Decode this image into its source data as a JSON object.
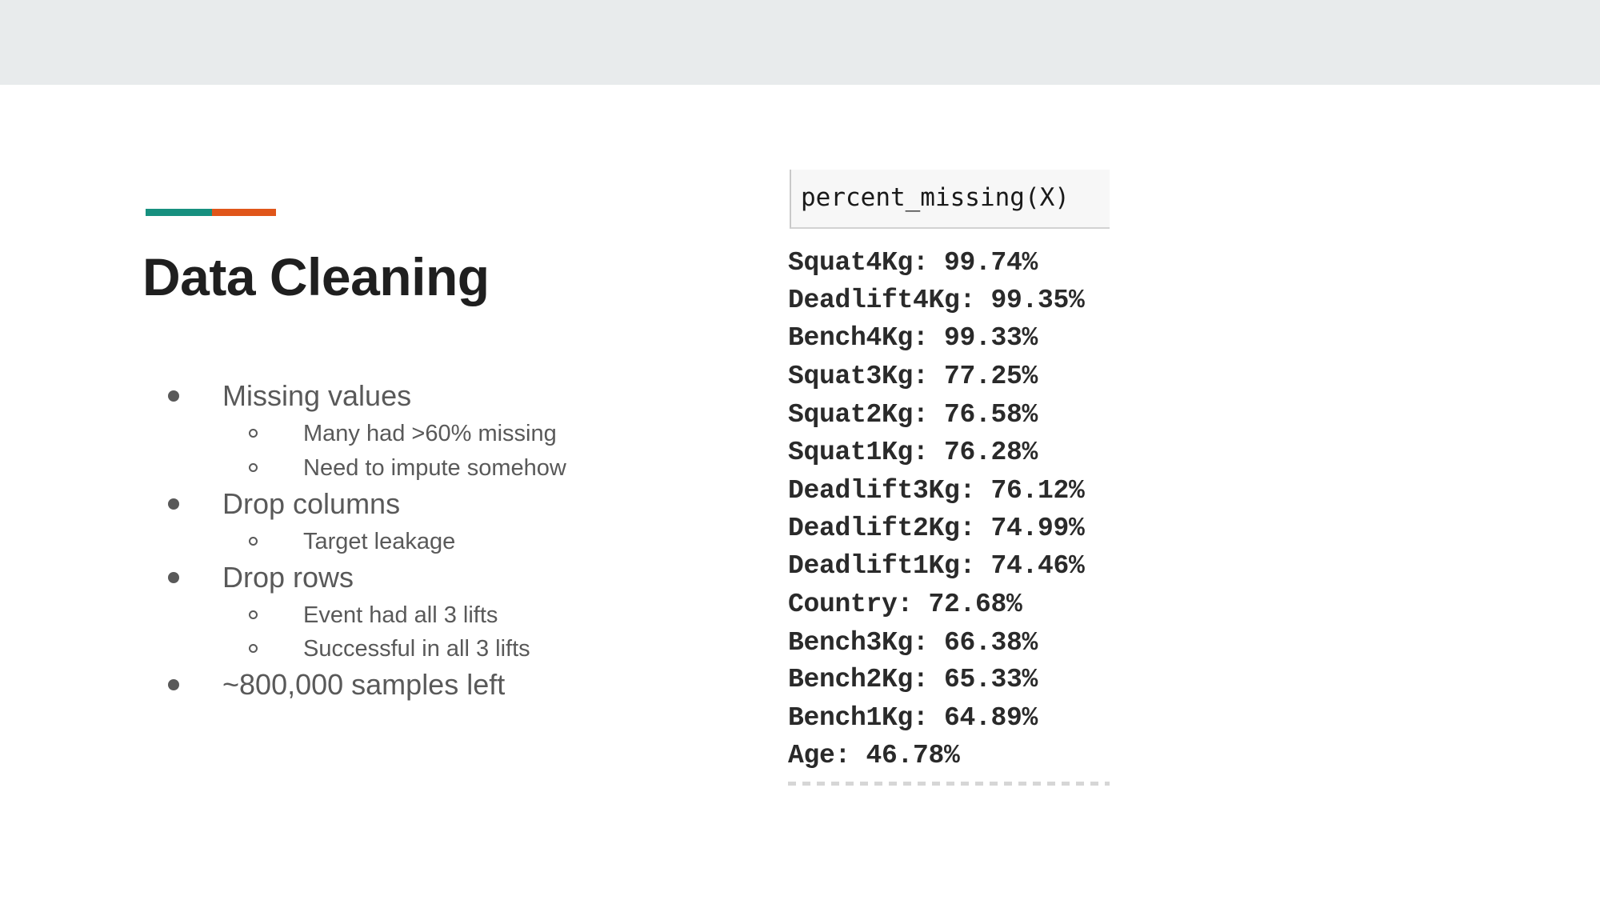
{
  "slide": {
    "title": "Data Cleaning",
    "accent_colors": {
      "teal": "#17907f",
      "orange": "#e0561a"
    },
    "bullets": [
      {
        "text": "Missing values",
        "level": 1
      },
      {
        "text": "Many had >60% missing",
        "level": 2
      },
      {
        "text": "Need to impute somehow",
        "level": 2
      },
      {
        "text": "Drop columns",
        "level": 1
      },
      {
        "text": "Target leakage",
        "level": 2
      },
      {
        "text": "Drop rows",
        "level": 1
      },
      {
        "text": "Event had all 3 lifts",
        "level": 2
      },
      {
        "text": "Successful in all 3 lifts",
        "level": 2
      },
      {
        "text": "~800,000 samples left",
        "level": 1
      }
    ]
  },
  "code_screenshot": {
    "input": "percent_missing(X)",
    "output": [
      "Squat4Kg: 99.74%",
      "Deadlift4Kg: 99.35%",
      "Bench4Kg: 99.33%",
      "Squat3Kg: 77.25%",
      "Squat2Kg: 76.58%",
      "Squat1Kg: 76.28%",
      "Deadlift3Kg: 76.12%",
      "Deadlift2Kg: 74.99%",
      "Deadlift1Kg: 74.46%",
      "Country: 72.68%",
      "Bench3Kg: 66.38%",
      "Bench2Kg: 65.33%",
      "Bench1Kg: 64.89%",
      "Age: 46.78%"
    ]
  }
}
